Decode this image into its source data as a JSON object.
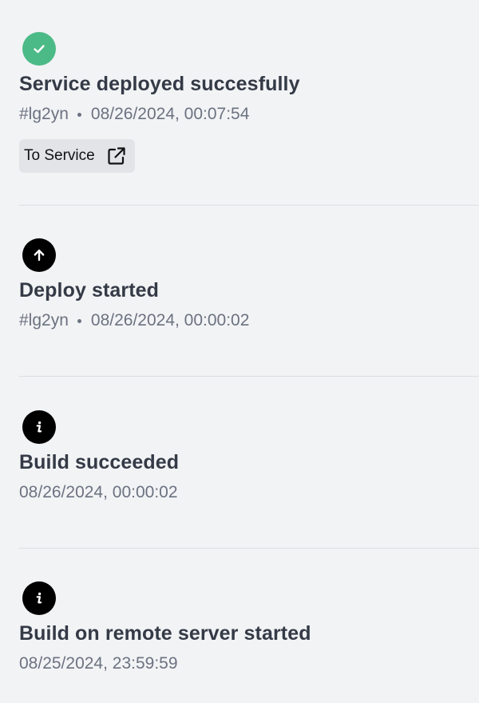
{
  "events": [
    {
      "title": "Service deployed succesfully",
      "id": "#lg2yn",
      "timestamp": "08/26/2024, 00:07:54",
      "icon": "check-icon",
      "status_color": "#4cba86",
      "action_label": "To Service"
    },
    {
      "title": "Deploy started",
      "id": "#lg2yn",
      "timestamp": "08/26/2024, 00:00:02",
      "icon": "arrow-up-icon"
    },
    {
      "title": "Build succeeded",
      "timestamp": "08/26/2024, 00:00:02",
      "icon": "info-icon"
    },
    {
      "title": "Build on remote server started",
      "timestamp": "08/25/2024, 23:59:59",
      "icon": "info-icon"
    }
  ]
}
